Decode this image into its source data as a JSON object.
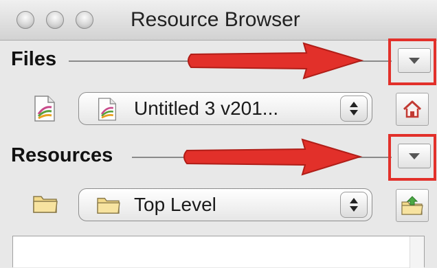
{
  "window": {
    "title": "Resource Browser",
    "traffic_lights": [
      "close-button",
      "minimize-button",
      "zoom-button"
    ]
  },
  "files": {
    "label": "Files",
    "popup_value": "Untitled 3 v201...",
    "file_icon": "document-icon",
    "home_icon": "home-icon",
    "disclosure_icon": "triangle-down-icon"
  },
  "resources": {
    "label": "Resources",
    "popup_value": "Top Level",
    "folder_icon": "folder-icon",
    "up_icon": "folder-up-icon",
    "disclosure_icon": "triangle-down-icon"
  },
  "colors": {
    "highlight": "#e2302a",
    "arrow": "#e2302a",
    "window_bg": "#e8e8e8"
  }
}
